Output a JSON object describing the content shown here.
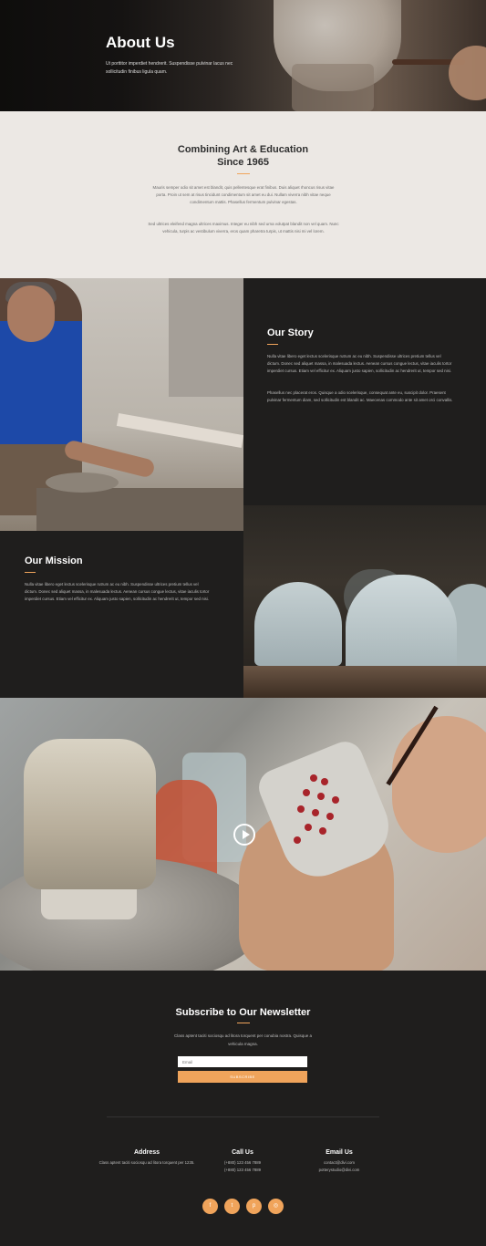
{
  "hero": {
    "title": "About Us",
    "subtitle": "Ut porttitor imperdiet hendrerit. Suspendisse pulvinar lacus nec sollicitudin finibus ligula quam."
  },
  "intro": {
    "title_line1": "Combining Art & Education",
    "title_line2": "Since 1965",
    "paragraph1": "Mauris semper odio sit amet est blandit, quis pellentesque erat finibus. Duis aliquet rhoncus risus vitae porta. Proin ut sem at risus tincidunt condimentum sit amet eu dui. Nullam viverra nibh vitae neque condimentum mattis. Phasellus fermentum pulvinar egestas.",
    "paragraph2": "Sed ultrices eleifend magna ultrices maximus. Integer eu nibh sed urna volutpat blandit non vel quam. Nunc vehicula, turpis ac vestibulum viverra, eros quam pharetra turpis, ut mattis nisi mi vel lorem."
  },
  "story": {
    "title": "Our Story",
    "paragraph1": "Nulla vitae libero eget lectus scelerisque rutrum ac eu nibh. Suspendisse ultrices pretium tellus vel dictum. Donec sed aliquet massa, in malesuada lectus. Aenean cursus congue lectus, vitae iaculis tortor imperdiet cursus. Etiam vel efficitur ex. Aliquam justo sapien, sollicitudin ac hendrerit ut, tempor sed nisi.",
    "paragraph2": "Phasellus nec placerat eros. Quisque a odio scelerisque, consequat ante eu, suscipit dolor. Praesent pulvinar fermentum diam, sed sollicitudin est blandit ac. Maecenas commodo ante sit amet orci convallis."
  },
  "mission": {
    "title": "Our Mission",
    "paragraph": "Nulla vitae libero eget lectus scelerisque rutrum ac eu nibh. Suspendisse ultrices pretium tellus vel dictum. Donec sed aliquet massa, in malesuada lectus. Aenean cursus congue lectus, vitae iaculis tortor imperdiet cursus. Etiam vel efficitur ex. Aliquam justo sapien, sollicitudin ac hendrerit ut, tempor sed nisi."
  },
  "video": {
    "play_icon": "play-icon"
  },
  "newsletter": {
    "title": "Subscribe to Our Newsletter",
    "description": "Class aptent taciti sociosqu ad litora torquent per conubia nostra. Quisque a vehicula magna.",
    "email_placeholder": "Email",
    "subscribe_label": "SUBSCRIBE"
  },
  "contact": {
    "address_title": "Address",
    "address_text": "Class aptent taciti sociosqu ad litora torquent per 1235.",
    "call_title": "Call Us",
    "phone1": "(+880) 123 456 7889",
    "phone2": "(+880) 123 456 7889",
    "email_title": "Email Us",
    "email1": "contact@divi.com",
    "email2": "potterystudio@divi.com"
  },
  "socials": [
    {
      "icon": "facebook-icon",
      "glyph": "f"
    },
    {
      "icon": "twitter-icon",
      "glyph": "t"
    },
    {
      "icon": "pinterest-icon",
      "glyph": "p"
    },
    {
      "icon": "instagram-icon",
      "glyph": "◎"
    }
  ],
  "colors": {
    "accent": "#f0a45b",
    "dark": "#1f1e1d",
    "light": "#ece8e4"
  }
}
